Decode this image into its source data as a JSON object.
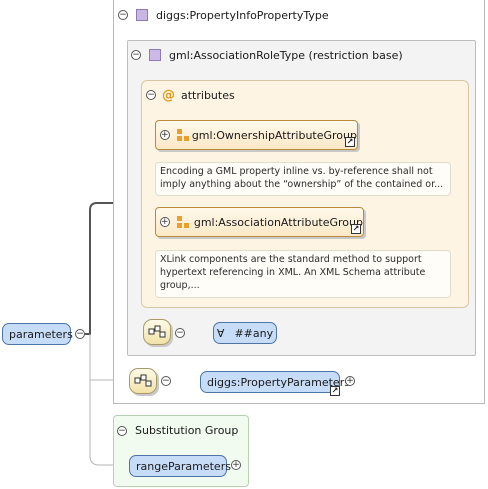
{
  "type": {
    "name": "diggs:PropertyInfoPropertyType"
  },
  "base": {
    "name": "gml:AssociationRoleType (restriction base)"
  },
  "attributes": {
    "label": "attributes"
  },
  "attribute_groups": [
    {
      "name": "gml:OwnershipAttributeGroup",
      "doc": "Encoding a GML property inline vs. by-reference shall not imply anything about the “ownership” of the contained or..."
    },
    {
      "name": "gml:AssociationAttributeGroup",
      "doc": "XLink components are the standard method to support hypertext referencing in XML. An XML Schema attribute group,..."
    }
  ],
  "any": {
    "label": "##any",
    "symbol": "∀"
  },
  "element": {
    "name": "parameters"
  },
  "child": {
    "name": "diggs:PropertyParameters"
  },
  "substitution": {
    "label": "Substitution Group",
    "member": "rangeParameters"
  },
  "colors": {
    "element_fill": "#c7dcf7",
    "element_border": "#4e74a8",
    "attribute_fill": "#fdf4e3",
    "attribute_icon": "#e8a02a",
    "type_icon": "#c9b7e3",
    "substitution_fill": "#f1fbef"
  }
}
